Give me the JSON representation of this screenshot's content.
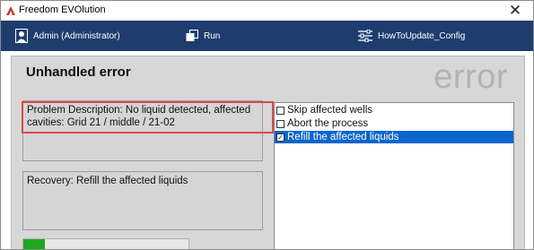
{
  "window": {
    "title": "Freedom EVOlution",
    "close_glyph": "✕"
  },
  "topbar": {
    "user_label": "Admin (Administrator)",
    "run_label": "Run",
    "config_label": "HowToUpdate_Config",
    "background": "#1e3d6e"
  },
  "dialog": {
    "title": "Unhandled error",
    "watermark": "error",
    "problem_text": "Problem Description: No liquid detected, affected cavities: Grid 21 / middle / 21-02",
    "recovery_text": "Recovery: Refill the affected liquids",
    "options": [
      {
        "label": "Skip affected wells",
        "checked": false,
        "selected": false
      },
      {
        "label": "Abort the process",
        "checked": false,
        "selected": false
      },
      {
        "label": "Refill the affected liquids",
        "checked": true,
        "selected": true
      }
    ],
    "progress_fraction": 0.13,
    "selection_color": "#0a66cc",
    "highlight_color": "#d84a4a"
  }
}
